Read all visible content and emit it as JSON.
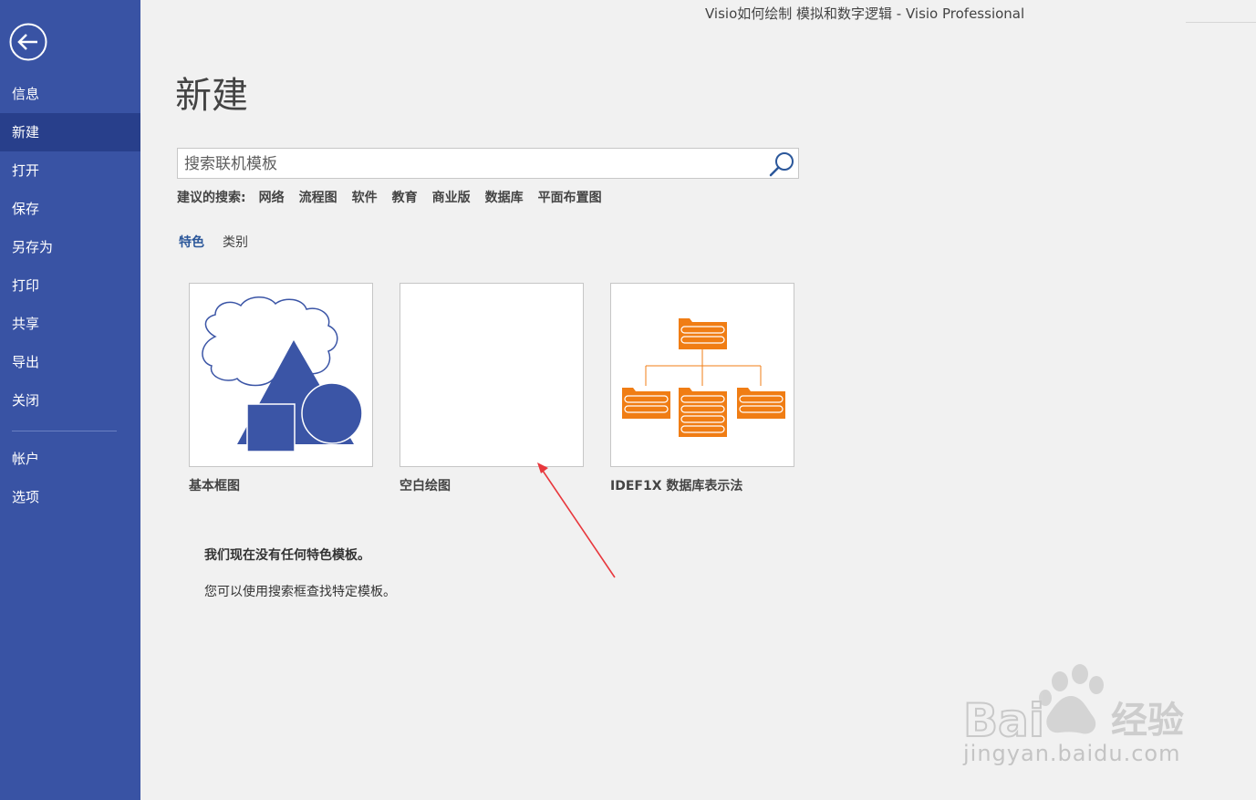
{
  "window": {
    "title": "Visio如何绘制 模拟和数字逻辑 - Visio Professional"
  },
  "sidebar": {
    "items": [
      {
        "label": "信息"
      },
      {
        "label": "新建"
      },
      {
        "label": "打开"
      },
      {
        "label": "保存"
      },
      {
        "label": "另存为"
      },
      {
        "label": "打印"
      },
      {
        "label": "共享"
      },
      {
        "label": "导出"
      },
      {
        "label": "关闭"
      },
      {
        "label": "帐户"
      },
      {
        "label": "选项"
      }
    ],
    "active": "新建"
  },
  "main": {
    "title": "新建",
    "search": {
      "placeholder": "搜索联机模板"
    },
    "suggested": {
      "label": "建议的搜索:",
      "links": [
        "网络",
        "流程图",
        "软件",
        "教育",
        "商业版",
        "数据库",
        "平面布置图"
      ]
    },
    "tabs": [
      {
        "label": "特色",
        "active": true
      },
      {
        "label": "类别",
        "active": false
      }
    ],
    "templates": [
      {
        "label": "基本框图"
      },
      {
        "label": "空白绘图"
      },
      {
        "label": "IDEF1X 数据库表示法"
      }
    ],
    "message_title": "我们现在没有任何特色模板。",
    "message_body": "您可以使用搜索框查找特定模板。"
  },
  "colors": {
    "sidebar_bg": "#3953a4",
    "sidebar_active": "#283f8b",
    "accent": "#2b579a",
    "shape_blue": "#3b55a6",
    "db_orange": "#f07d14",
    "annotation_arrow": "#e8383d"
  },
  "watermark": {
    "text": "jingyan.baidu.com"
  }
}
